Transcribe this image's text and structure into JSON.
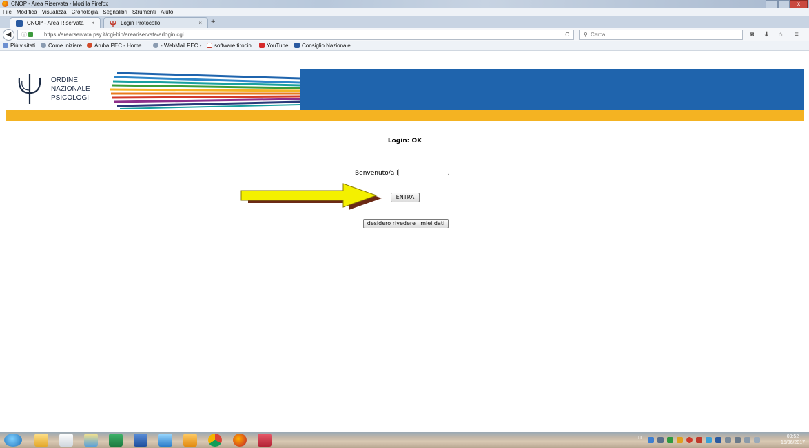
{
  "window": {
    "title": "CNOP - Area Riservata - Mozilla Firefox",
    "controls": {
      "close": "x"
    }
  },
  "menu": [
    "File",
    "Modifica",
    "Visualizza",
    "Cronologia",
    "Segnalibri",
    "Strumenti",
    "Aiuto"
  ],
  "tabs": [
    {
      "label": "CNOP - Area Riservata",
      "close": "×"
    },
    {
      "label": "Login Protocollo",
      "close": "×"
    }
  ],
  "newtab": "+",
  "nav": {
    "url": "https://arearservata.psy.it/cgi-bin/areariservata/arlogin.cgi",
    "search_placeholder": "Cerca"
  },
  "bookmarks": [
    "Più visitati",
    "Come iniziare",
    "Aruba PEC - Home",
    "- WebMail PEC -",
    "software tirocini",
    "YouTube",
    "Consiglio Nazionale ..."
  ],
  "logo": {
    "line1": "ORDINE",
    "line2": "NAZIONALE",
    "line3": "PSICOLOGI"
  },
  "content": {
    "login_status": "Login: OK",
    "welcome": "Benvenuto/a",
    "welcome_initial": "l",
    "welcome_end": ".",
    "enter_button": "ENTRA",
    "review_button": "desidero rivedere i miei dati"
  },
  "taskbar": {
    "lang": "IT",
    "time": "09:52",
    "date": "15/06/2017"
  },
  "colors": {
    "header_blue": "#1f64ad",
    "accent_orange": "#f4b322",
    "arrow_yellow": "#f4f000",
    "arrow_shadow": "#6b2a16"
  }
}
